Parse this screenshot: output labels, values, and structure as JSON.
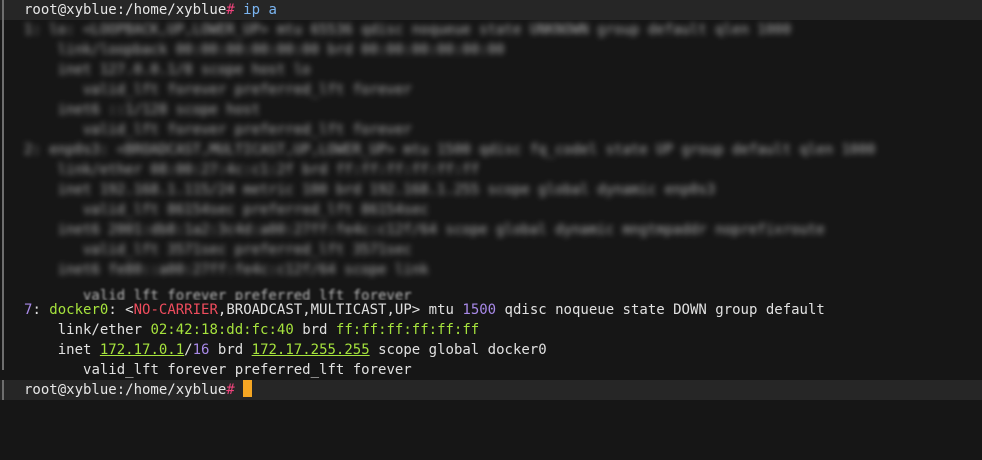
{
  "prompt": "root@xyblue:/home/xyblue",
  "prompt_symbol": "#",
  "command": "ip a",
  "blurred_output": [
    "1: lo: <LOOPBACK,UP,LOWER_UP> mtu 65536 qdisc noqueue state UNKNOWN group default qlen 1000",
    "    link/loopback 00:00:00:00:00:00 brd 00:00:00:00:00:00",
    "    inet 127.0.0.1/8 scope host lo",
    "       valid_lft forever preferred_lft forever",
    "    inet6 ::1/128 scope host",
    "       valid_lft forever preferred_lft forever",
    "2: enp0s3: <BROADCAST,MULTICAST,UP,LOWER_UP> mtu 1500 qdisc fq_codel state UP group default qlen 1000",
    "    link/ether 08:00:27:4c:c1:2f brd ff:ff:ff:ff:ff:ff",
    "    inet 192.168.1.115/24 metric 100 brd 192.168.1.255 scope global dynamic enp0s3",
    "       valid_lft 86154sec preferred_lft 86154sec",
    "    inet6 2001:db8:1a2:3c4d:a00:27ff:fe4c:c12f/64 scope global dynamic mngtmpaddr noprefixroute",
    "       valid_lft 3571sec preferred_lft 3571sec",
    "    inet6 fe80::a00:27ff:fe4c:c12f/64 scope link"
  ],
  "partial_line": "       valid_lft forever preferred_lft forever",
  "docker": {
    "index": "7",
    "name": "docker0",
    "flags_open": "<",
    "flag_nocarrier": "NO-CARRIER",
    "flags_rest": ",BROADCAST,MULTICAST,UP",
    "flags_close": ">",
    "mtu_label": "mtu",
    "mtu": "1500",
    "after_mtu": "qdisc noqueue state DOWN group default",
    "link_label": "link/ether",
    "mac": "02:42:18:dd:fc:40",
    "brd_label": "brd",
    "brd_mac": "ff:ff:ff:ff:ff:ff",
    "inet_label": "inet",
    "ip": "172.17.0.1",
    "prefix": "16",
    "brd_ip": "172.17.255.255",
    "scope": "scope global docker0",
    "valid": "valid_lft forever preferred_lft forever"
  },
  "colors": {
    "background": "#161616",
    "highlight": "#262626",
    "prompt_symbol": "#f0437c",
    "command": "#7ab4f0",
    "number": "#a889e8",
    "green": "#a6e33d",
    "red": "#ef4c5d",
    "cursor": "#f5a623"
  }
}
